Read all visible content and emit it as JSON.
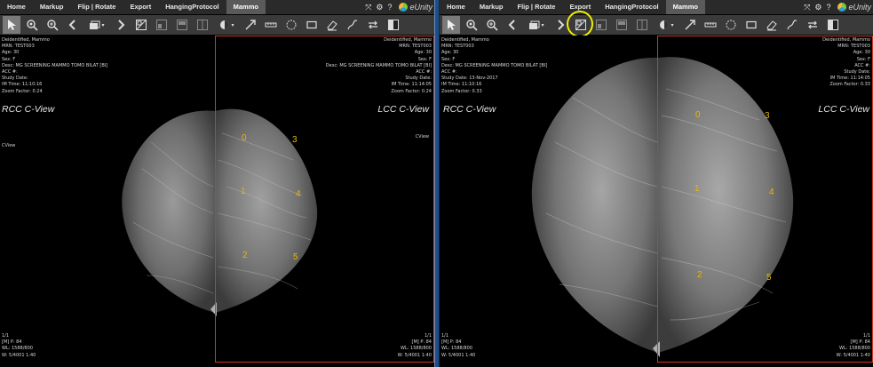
{
  "menu": {
    "items": [
      {
        "label": "Home"
      },
      {
        "label": "Markup"
      },
      {
        "label": "Flip | Rotate"
      },
      {
        "label": "Export"
      },
      {
        "label": "HangingProtocol"
      },
      {
        "label": "Mammo"
      }
    ],
    "active": "Mammo",
    "logo_text": "eUnity"
  },
  "colors": {
    "frame_border": "#d03a2a",
    "marker_number": "#e6b800",
    "highlight_ring": "#f0f000",
    "divider": "#1c4f8a"
  },
  "toolbar": {
    "tools": [
      "pointer-icon",
      "magnify-icon",
      "zoom-icon",
      "prev-icon",
      "stack-icon",
      "next-icon",
      "layout-icon",
      "layout-a-icon",
      "layout-b-icon",
      "layout-c-icon",
      "window-level-icon",
      "arrow-icon",
      "ruler-icon",
      "ellipse-icon",
      "rectangle-icon",
      "eraser-icon",
      "freehand-icon",
      "swap-icon",
      "split-icon"
    ],
    "selected": "pointer-icon",
    "highlighted_right": "layout-icon"
  },
  "left_view": {
    "rcc": {
      "title": "RCC C-View",
      "patient": "Deidentified, Mammo",
      "mrn": "MRN: TEST003",
      "age": "Age: 30",
      "sex": "Sex: F",
      "desc": "Desc: MG SCREENING MAMMO TOMO BILAT [BI]",
      "acc": "ACC #:",
      "study_date": "Study Date:",
      "im_time": "IM Time: 11:10:16",
      "zoom": "Zoom Factor: 0.24",
      "side_note": "CView",
      "corner": "1/1",
      "footer_1": "[M] P: 84",
      "footer_2": "WL: 1588/800",
      "footer_3": "W: 5/4001 1:40"
    },
    "lcc": {
      "title": "LCC C-View",
      "patient": "Deidentified, Mammo",
      "mrn": "MRN: TEST003",
      "age": "Age: 30",
      "sex": "Sex: F",
      "desc": "Desc: MG SCREENING MAMMO TOMO BILAT [BI]",
      "acc": "ACC #:",
      "study_date": "Study Date:",
      "im_time": "IM Time: 11:14:05",
      "zoom": "Zoom Factor: 0.24",
      "side_note": "CView",
      "corner": "1/1",
      "footer_1": "[M] P: 84",
      "footer_2": "WL: 1588/800",
      "footer_3": "W: 5/4001 1:40"
    },
    "markers": [
      "0",
      "1",
      "2",
      "3",
      "4",
      "5"
    ]
  },
  "right_view": {
    "rcc": {
      "title": "RCC C-View",
      "patient": "Deidentified, Mammo",
      "mrn": "MRN: TEST003",
      "age": "Age: 30",
      "sex": "Sex: F",
      "desc": "Desc: MG SCREENING MAMMO TOMO BILAT [BI]",
      "acc": "ACC #:",
      "study_date": "Study Date: 13-Nov-2017",
      "im_time": "IM Time: 11:10:16",
      "zoom": "Zoom Factor: 0.33",
      "corner": "1/1",
      "footer_1": "[M] P: 84",
      "footer_2": "WL: 1588/800",
      "footer_3": "W: 5/4001 1:40"
    },
    "lcc": {
      "title": "LCC C-View",
      "patient": "Deidentified, Mammo",
      "mrn": "MRN: TEST003",
      "age": "Age: 30",
      "sex": "Sex: F",
      "acc": "ACC #:",
      "study_date": "Study Date:",
      "im_time": "IM Time: 11:14:05",
      "zoom": "Zoom Factor: 0.33",
      "corner": "1/1",
      "footer_1": "[M] P: 84",
      "footer_2": "WL: 1588/800",
      "footer_3": "W: 5/4001 1:40"
    },
    "markers": [
      "0",
      "1",
      "2",
      "3",
      "4",
      "5"
    ]
  }
}
